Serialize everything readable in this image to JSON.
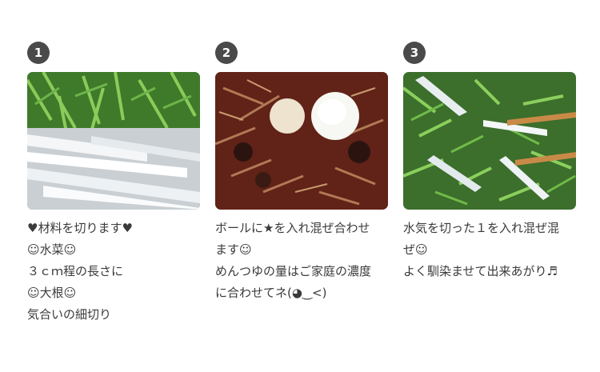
{
  "steps": [
    {
      "number": "1",
      "photo_icon": "mizuna-and-daikon-photo",
      "lines": [
        "♥材料を切ります♥",
        "☺水菜☺",
        "３ｃｍ程の長さに",
        "☺大根☺",
        "気合いの細切り"
      ]
    },
    {
      "number": "2",
      "photo_icon": "dressing-mix-bowl-photo",
      "lines": [
        "ボールに★を入れ混ぜ合わせ",
        "ます☺",
        "めんつゆの量はご家庭の濃度",
        "に合わせてネ(◕‿<)"
      ]
    },
    {
      "number": "3",
      "photo_icon": "mixed-salad-chopsticks-photo",
      "lines": [
        "水気を切った１を入れ混ぜ混",
        "ぜ☺",
        "よく馴染ませて出来あがり♬"
      ]
    }
  ]
}
